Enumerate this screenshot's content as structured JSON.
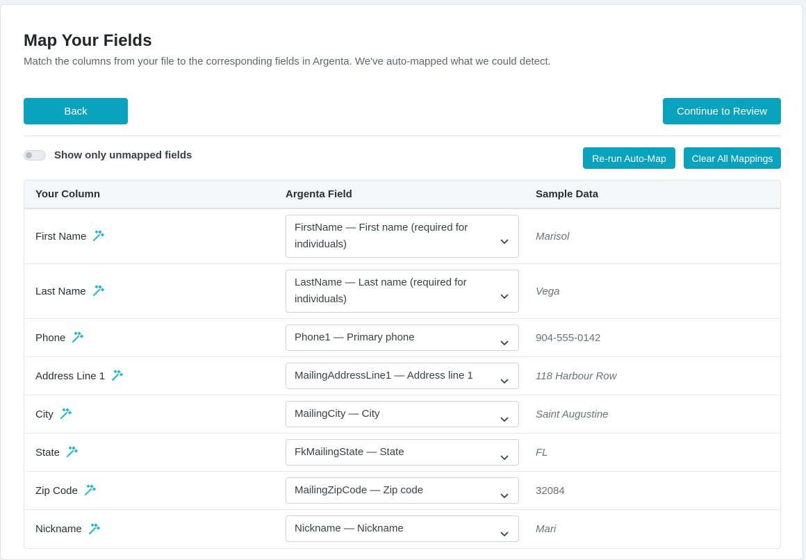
{
  "header": {
    "title": "Map Your Fields",
    "subtitle": "Match the columns from your file to the corresponding fields in Argenta. We've auto-mapped what we could detect."
  },
  "actions": {
    "back_label": "Back",
    "continue_label": "Continue to Review",
    "toggle_label": "Show only unmapped fields",
    "toggle_on": false,
    "rerun_label": "Re-run Auto-Map",
    "clear_label": "Clear All Mappings"
  },
  "table": {
    "headers": [
      "Your Column",
      "Argenta Field",
      "Sample Data"
    ],
    "rows": [
      {
        "column": "First Name",
        "field": "FirstName — First name (required for individuals)",
        "sample": "Marisol"
      },
      {
        "column": "Last Name",
        "field": "LastName — Last name (required for individuals)",
        "sample": "Vega"
      },
      {
        "column": "Phone",
        "field": "Phone1 — Primary phone",
        "sample": "904-555-0142"
      },
      {
        "column": "Address Line 1",
        "field": "MailingAddressLine1 — Address line 1",
        "sample": "118 Harbour Row"
      },
      {
        "column": "City",
        "field": "MailingCity — City",
        "sample": "Saint Augustine"
      },
      {
        "column": "State",
        "field": "FkMailingState — State",
        "sample": "FL"
      },
      {
        "column": "Zip Code",
        "field": "MailingZipCode — Zip code",
        "sample": "32084"
      },
      {
        "column": "Nickname",
        "field": "Nickname — Nickname",
        "sample": "Mari"
      }
    ]
  },
  "icons": {
    "auto_mapped": "magic-wand-icon",
    "dropdown": "chevron-down-icon"
  },
  "colors": {
    "accent": "#0aa3bd",
    "wand": "#1ab7d6"
  }
}
